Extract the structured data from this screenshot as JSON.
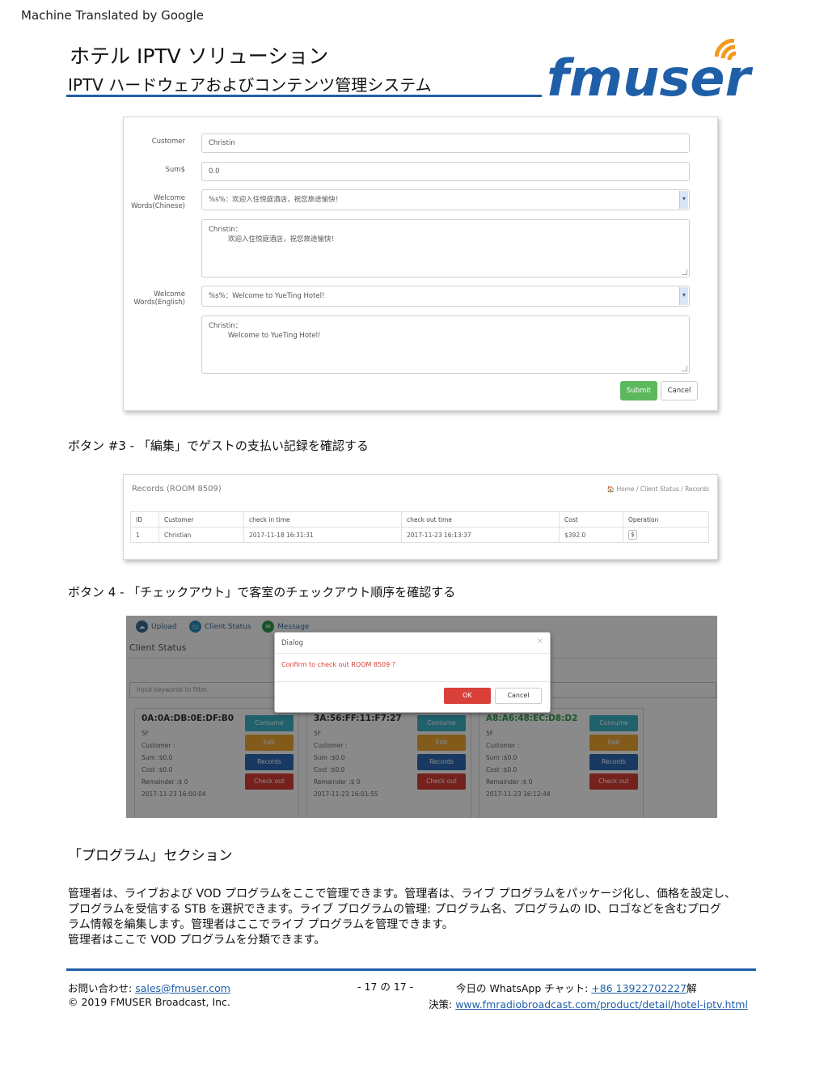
{
  "header": {
    "machine_translated": "Machine Translated by Google",
    "title": "ホテル IPTV ソリューション",
    "subtitle": "IPTV ハードウェアおよびコンテンツ管理システム",
    "logo_text": "fmuser"
  },
  "form_screenshot": {
    "customer_label": "Customer",
    "customer_value": "Christin",
    "sum_label": "Sum$",
    "sum_value": "0.0",
    "welcome_cn_label_1": "Welcome",
    "welcome_cn_label_2": "Words(Chinese)",
    "welcome_cn_select": "%s%：欢迎入住悦庭酒店，祝您旅途愉快！",
    "welcome_cn_text_1": "Christin：",
    "welcome_cn_text_2": "欢迎入住悦庭酒店，祝您旅途愉快！",
    "welcome_en_label_1": "Welcome",
    "welcome_en_label_2": "Words(English)",
    "welcome_en_select": "%s%：Welcome to YueTing Hotel!",
    "welcome_en_text_1": "Christin：",
    "welcome_en_text_2": "Welcome to YueTing Hotel!",
    "submit_label": "Submit",
    "cancel_label": "Cancel"
  },
  "caption_3": "ボタン #3 - 「編集」でゲストの支払い記録を確認する",
  "records_screenshot": {
    "title": "Records (ROOM 8509)",
    "breadcrumb": "🏠 Home / Client Status / Records",
    "columns": [
      "ID",
      "Customer",
      "check in time",
      "check out time",
      "Cost",
      "Operation"
    ],
    "row": {
      "id": "1",
      "customer": "Christian",
      "check_in": "2017-11-18 16:31:31",
      "check_out": "2017-11-23 16:13:37",
      "cost": "$392.0",
      "operation": "$"
    }
  },
  "caption_4": "ボタン 4 - 「チェックアウト」で客室のチェックアウト順序を確認する",
  "client_status_screenshot": {
    "nav": [
      "Upload",
      "Client Status",
      "Message"
    ],
    "title": "Client Status",
    "filter_placeholder": "Input keywords to filter.",
    "cards": [
      {
        "mac": "0A:0A:DB:0E:DF:B0",
        "floor": "5F",
        "customer": "Customer :",
        "sum": "Sum :$0.0",
        "cost": "Cost :$0.0",
        "remainder": "Remainder :$ 0",
        "time": "2017-11-23 16:00:04"
      },
      {
        "mac": "3A:56:FF:11:F7:27",
        "floor": "5F",
        "customer": "Customer :",
        "sum": "Sum :$0.0",
        "cost": "Cost :$0.0",
        "remainder": "Remainder :$ 0",
        "time": "2017-11-23 16:01:55"
      },
      {
        "mac": "A8:A6:48:EC:D8:D2",
        "floor": "5F",
        "customer": "Customer :",
        "sum": "Sum :$0.0",
        "cost": "Cost :$0.0",
        "remainder": "Remainder :$ 0",
        "time": "2017-11-23 16:12:44"
      }
    ],
    "card_buttons": {
      "consume": "Consume",
      "edit": "Edit",
      "records": "Records",
      "checkout": "Check out"
    },
    "dialog": {
      "title": "Dialog",
      "close": "×",
      "message": "Confirm to check out ROOM 8509 ?",
      "ok": "OK",
      "cancel": "Cancel"
    }
  },
  "section_title": "「プログラム」セクション",
  "paragraph": {
    "line1": "管理者は、ライブおよび VOD プログラムをここで管理できます。管理者は、ライブ プログラムをパッケージ化し、価格を設定し、",
    "line2": "プログラムを受信する STB を選択できます。ライブ プログラムの管理: プログラム名、プログラムの ID、ロゴなどを含むプログ",
    "line3": "ラム情報を編集します。管理者はここでライブ プログラムを管理できます。",
    "line4": "管理者はここで VOD プログラムを分類できます。"
  },
  "footer": {
    "contact_label": "お問い合わせ: ",
    "contact_email": "sales@fmuser.com",
    "copyright": "© 2019 FMUSER Broadcast, Inc.",
    "page": "- 17 の 17 -",
    "whatsapp_label": "今日の WhatsApp チャット: ",
    "whatsapp_number": "+86 13922702227",
    "whatsapp_suffix": "解",
    "solution_label": "決策: ",
    "solution_url": "www.fmradiobroadcast.com/product/detail/hotel-iptv.html"
  },
  "colors": {
    "brand_blue": "#1f5fa8",
    "logo_orange": "#f29a1e",
    "submit_green": "#5cb85c",
    "danger_red": "#d9403a"
  }
}
